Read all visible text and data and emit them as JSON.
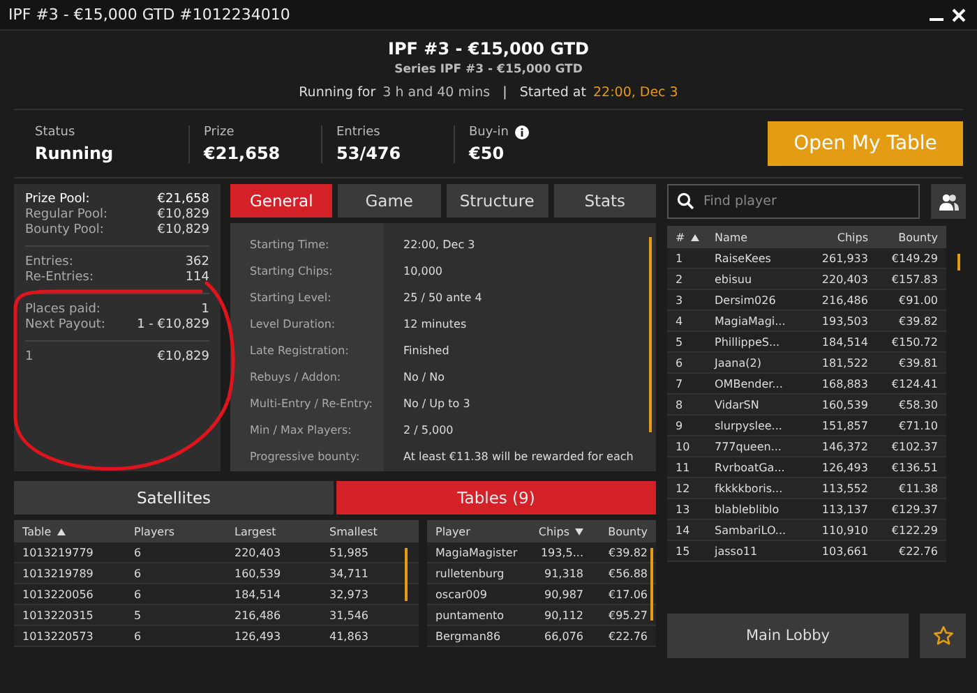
{
  "window": {
    "title": "IPF #3 - €15,000 GTD #1012234010"
  },
  "header": {
    "title": "IPF #3 - €15,000 GTD",
    "subtitle": "Series IPF #3 - €15,000 GTD",
    "running_label": "Running for",
    "running_value": "3 h and 40 mins",
    "separator": "|",
    "started_label": "Started at",
    "started_value": "22:00, Dec 3"
  },
  "stats": [
    {
      "label": "Status",
      "value": "Running",
      "info": false
    },
    {
      "label": "Prize",
      "value": "€21,658",
      "info": false
    },
    {
      "label": "Entries",
      "value": "53/476",
      "info": false
    },
    {
      "label": "Buy-in",
      "value": "€50",
      "info": true
    }
  ],
  "open_table_button": "Open My Table",
  "prize_summary": [
    [
      {
        "label": "Prize Pool:",
        "value": "€21,658",
        "strong": true
      },
      {
        "label": "Regular Pool:",
        "value": "€10,829",
        "strong": false
      },
      {
        "label": "Bounty Pool:",
        "value": "€10,829",
        "strong": false
      }
    ],
    [
      {
        "label": "Entries:",
        "value": "362",
        "strong": false
      },
      {
        "label": "Re-Entries:",
        "value": "114",
        "strong": false
      }
    ],
    [
      {
        "label": "Places paid:",
        "value": "1",
        "strong": false
      },
      {
        "label": "Next Payout:",
        "value": "1 - €10,829",
        "strong": false
      }
    ],
    [
      {
        "label": "1",
        "value": "€10,829",
        "strong": false
      }
    ]
  ],
  "detail_tabs": [
    {
      "label": "General",
      "selected": true
    },
    {
      "label": "Game",
      "selected": false
    },
    {
      "label": "Structure",
      "selected": false
    },
    {
      "label": "Stats",
      "selected": false
    }
  ],
  "general_details": [
    {
      "label": "Starting Time:",
      "value": "22:00, Dec 3"
    },
    {
      "label": "Starting Chips:",
      "value": "10,000"
    },
    {
      "label": "Starting Level:",
      "value": "25 / 50 ante 4"
    },
    {
      "label": "Level Duration:",
      "value": "12 minutes"
    },
    {
      "label": "Late Registration:",
      "value": "Finished"
    },
    {
      "label": "Rebuys / Addon:",
      "value": "No / No"
    },
    {
      "label": "Multi-Entry / Re-Entry:",
      "value": "No / Up to 3"
    },
    {
      "label": "Min / Max Players:",
      "value": "2 / 5,000"
    },
    {
      "label": "Progressive bounty:",
      "value": "At least €11.38 will be rewarded for each"
    }
  ],
  "search": {
    "placeholder": "Find player"
  },
  "players_table": {
    "columns": [
      {
        "label": "#",
        "sorted": true,
        "descending": false
      },
      {
        "label": "Name",
        "sorted": false
      },
      {
        "label": "Chips",
        "sorted": false
      },
      {
        "label": "Bounty",
        "sorted": false
      }
    ],
    "rows": [
      [
        "1",
        "RaiseKees",
        "261,933",
        "€149.29"
      ],
      [
        "2",
        "ebisuu",
        "220,403",
        "€157.83"
      ],
      [
        "3",
        "Dersim026",
        "216,486",
        "€91.00"
      ],
      [
        "4",
        "MagiaMagi...",
        "193,503",
        "€39.82"
      ],
      [
        "5",
        "PhillippeS...",
        "184,514",
        "€150.72"
      ],
      [
        "6",
        "Jaana(2)",
        "181,522",
        "€39.81"
      ],
      [
        "7",
        "OMBender...",
        "168,883",
        "€124.41"
      ],
      [
        "8",
        "VidarSN",
        "160,539",
        "€58.30"
      ],
      [
        "9",
        "slurpyslee...",
        "151,857",
        "€71.10"
      ],
      [
        "10",
        "777queen...",
        "146,372",
        "€102.37"
      ],
      [
        "11",
        "RvrboatGa...",
        "126,493",
        "€136.51"
      ],
      [
        "12",
        "fkkkkboris...",
        "113,552",
        "€11.38"
      ],
      [
        "13",
        "blablebliblo",
        "113,137",
        "€129.37"
      ],
      [
        "14",
        "SambariLO...",
        "110,910",
        "€122.29"
      ],
      [
        "15",
        "jasso11",
        "103,661",
        "€22.76"
      ]
    ]
  },
  "bottom_tabs": [
    {
      "label": "Satellites",
      "selected": false
    },
    {
      "label": "Tables (9)",
      "selected": true
    }
  ],
  "tables_list": {
    "columns": [
      {
        "label": "Table",
        "sorted": true,
        "descending": false
      },
      {
        "label": "Players",
        "sorted": false
      },
      {
        "label": "Largest",
        "sorted": false
      },
      {
        "label": "Smallest",
        "sorted": false
      }
    ],
    "rows": [
      [
        "1013219779",
        "6",
        "220,403",
        "51,985"
      ],
      [
        "1013219789",
        "6",
        "160,539",
        "34,711"
      ],
      [
        "1013220056",
        "6",
        "184,514",
        "32,973"
      ],
      [
        "1013220315",
        "5",
        "216,486",
        "31,546"
      ],
      [
        "1013220573",
        "6",
        "126,493",
        "41,863"
      ]
    ]
  },
  "table_players": {
    "columns": [
      {
        "label": "Player",
        "sorted": false
      },
      {
        "label": "Chips",
        "sorted": true,
        "descending": true
      },
      {
        "label": "Bounty",
        "sorted": false
      }
    ],
    "rows": [
      [
        "MagiaMagister",
        "193,5...",
        "€39.82"
      ],
      [
        "rulletenburg",
        "91,318",
        "€56.88"
      ],
      [
        "oscar009",
        "90,987",
        "€17.06"
      ],
      [
        "puntamento",
        "90,112",
        "€95.27"
      ],
      [
        "Bergman86",
        "66,076",
        "€22.76"
      ]
    ]
  },
  "main_lobby_button": "Main Lobby"
}
